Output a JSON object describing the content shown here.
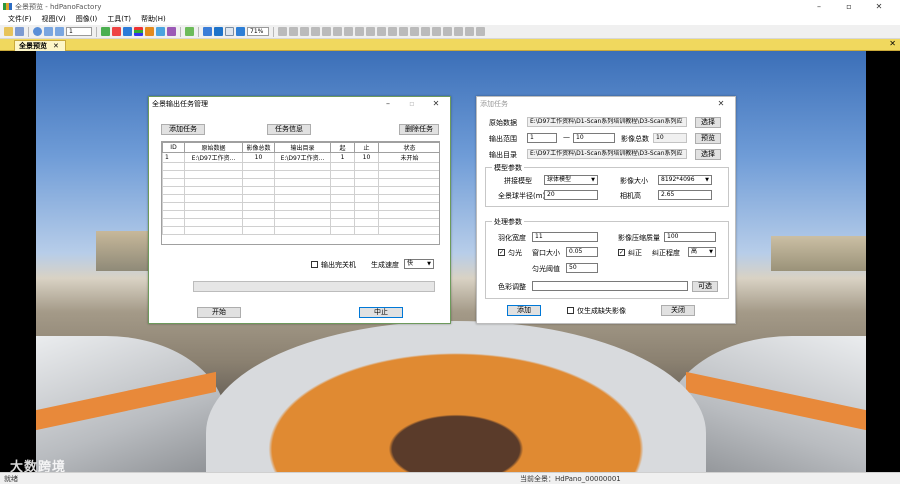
{
  "window": {
    "title": "全景预览 - hdPanoFactory",
    "minimize": "–",
    "maximize": "▫",
    "close": "✕"
  },
  "menu": [
    "文件(F)",
    "视图(V)",
    "图像(I)",
    "工具(T)",
    "帮助(H)"
  ],
  "toolbar": {
    "frame_value": "1",
    "zoom_value": "71%"
  },
  "tab": {
    "label": "全景预览",
    "close": "✕",
    "pane_close": "✕"
  },
  "task_manager": {
    "title": "全景输出任务管理",
    "add_label": "添加任务",
    "info_label": "任务信息",
    "delete_label": "删除任务",
    "columns": [
      "ID",
      "原始数据",
      "影像总数",
      "输出目录",
      "起",
      "止",
      "状态"
    ],
    "rows": [
      [
        "1",
        "E:\\D97工作资...",
        "10",
        "E:\\D97工作资...",
        "1",
        "10",
        "未开始"
      ]
    ],
    "shutdown_label": "输出完关机",
    "speed_label": "生成速度",
    "speed_value": "快",
    "start_label": "开始",
    "stop_label": "中止"
  },
  "add_task": {
    "title": "添加任务",
    "source_label": "原始数据",
    "source_value": "E:\\D97工作资料\\D1-Scan系列培训教程\\D3-Scan系列应",
    "browse_label": "选择",
    "range_label": "输出范围",
    "range_from": "1",
    "range_dash": "—",
    "range_to": "10",
    "total_label": "影像总数",
    "total_value": "10",
    "preview_label": "预览",
    "output_label": "输出目录",
    "output_value": "E:\\D97工作资料\\D1-Scan系列培训教程\\D3-Scan系列应",
    "output_browse_label": "选择",
    "model_group": "模型参数",
    "stitch_label": "拼接模型",
    "stitch_value": "球体模型",
    "size_label": "影像大小",
    "size_value": "8192*4096",
    "radius_label": "全景球半径(m)",
    "radius_value": "20",
    "height_label": "相机高",
    "height_value": "2.65",
    "proc_group": "处理参数",
    "feather_label": "羽化宽度",
    "feather_value": "11",
    "compress_label": "影像压缩质量",
    "compress_value": "100",
    "even_label": "匀光",
    "window_label": "窗口大小",
    "window_value": "0.05",
    "correct_label": "纠正",
    "level_label": "纠正程度",
    "level_value": "高",
    "threshold_label": "匀光阈值",
    "threshold_value": "50",
    "color_label": "色彩调整",
    "color_value": "",
    "optional_label": "可选",
    "add_label": "添加",
    "only_missing_label": "仅生成缺失影像",
    "close_label": "关闭"
  },
  "status": {
    "left": "就绪",
    "center": "当前全景：HdPano_00000001"
  },
  "watermark": "大数跨境"
}
